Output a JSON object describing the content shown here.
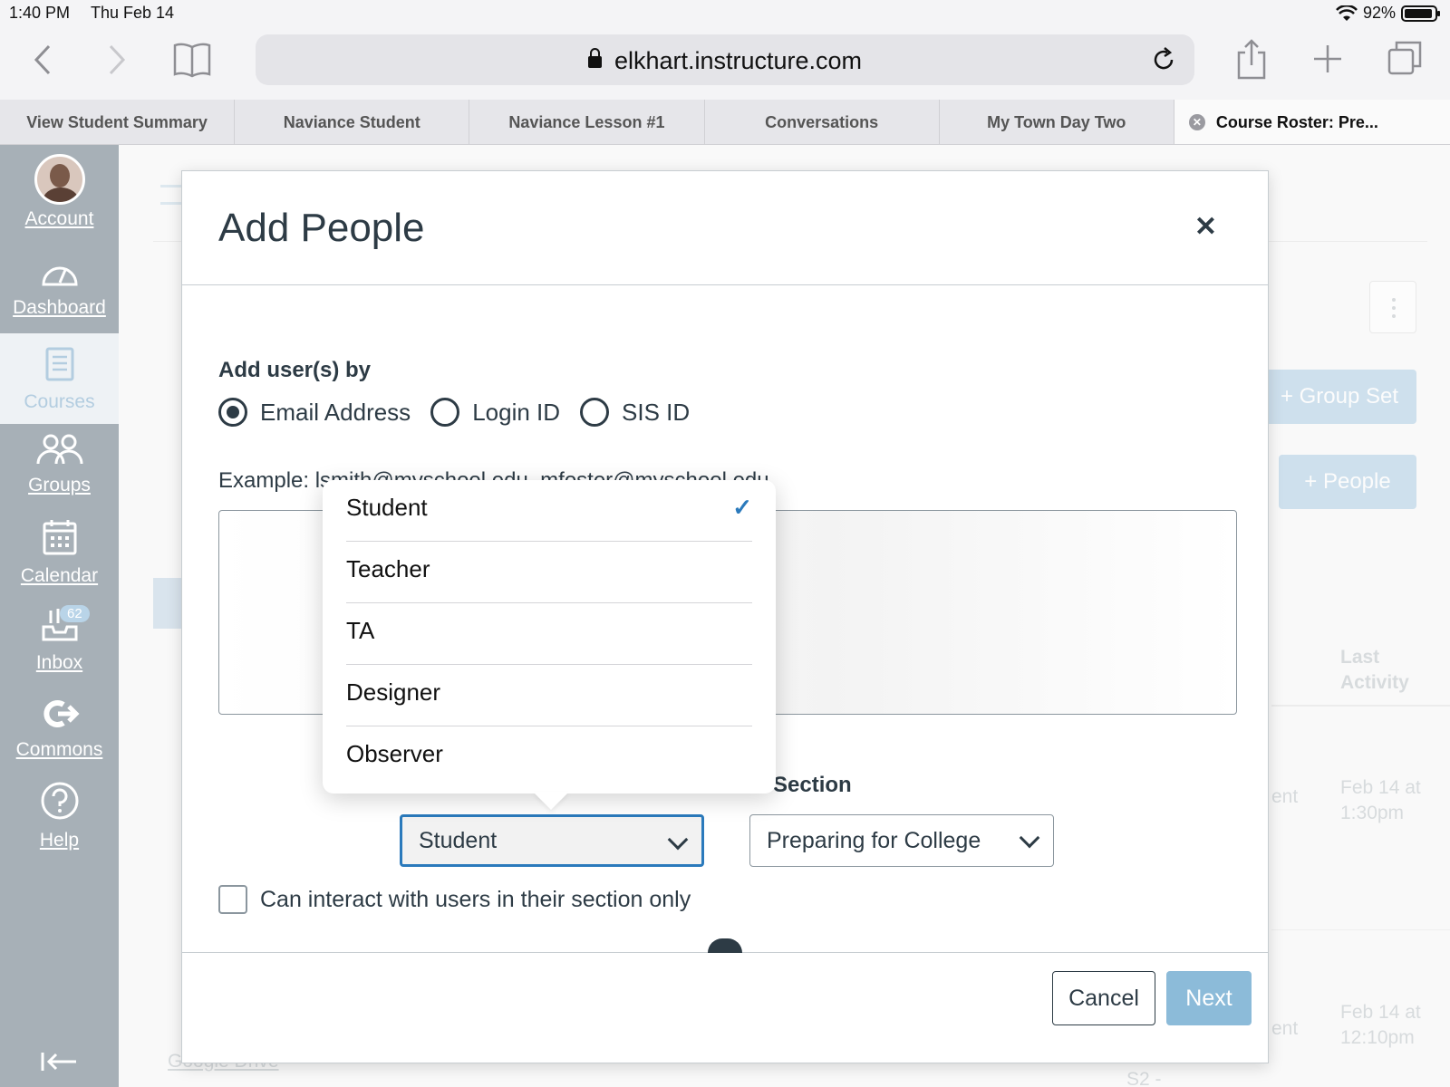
{
  "status_bar": {
    "time": "1:40 PM",
    "date": "Thu Feb 14",
    "battery": "92%"
  },
  "browser": {
    "url": "elkhart.instructure.com",
    "tabs": [
      {
        "label": "View Student Summary"
      },
      {
        "label": "Naviance Student"
      },
      {
        "label": "Naviance Lesson #1"
      },
      {
        "label": "Conversations"
      },
      {
        "label": "My Town Day Two"
      },
      {
        "label": "Course Roster: Pre..."
      }
    ]
  },
  "global_nav": {
    "items": [
      {
        "label": "Account",
        "icon": "avatar"
      },
      {
        "label": "Dashboard",
        "icon": "dashboard-icon"
      },
      {
        "label": "Courses",
        "icon": "courses-icon"
      },
      {
        "label": "Groups",
        "icon": "groups-icon"
      },
      {
        "label": "Calendar",
        "icon": "calendar-icon"
      },
      {
        "label": "Inbox",
        "icon": "inbox-icon",
        "badge": "62"
      },
      {
        "label": "Commons",
        "icon": "commons-icon"
      },
      {
        "label": "Help",
        "icon": "help-icon"
      }
    ]
  },
  "background": {
    "group_set_button": "Group Set",
    "people_button": "People",
    "column_last_activity": "Last Activity",
    "row1_activity": "Feb 14 at 1:30pm",
    "row2_activity": "Feb 14 at 12:10pm",
    "partial_ent1": "ent",
    "partial_ent2": "ent",
    "partial_s2": "S2 -",
    "partial_drive": "Google Drive"
  },
  "modal": {
    "title": "Add People",
    "add_by_label": "Add user(s) by",
    "radio_options": [
      {
        "label": "Email Address",
        "checked": true
      },
      {
        "label": "Login ID",
        "checked": false
      },
      {
        "label": "SIS ID",
        "checked": false
      }
    ],
    "example_text": "Example: lsmith@myschool.edu, mfoster@myschool.edu",
    "textarea_value": "",
    "section_heading": "Section",
    "role_value": "Student",
    "section_value": "Preparing for College",
    "checkbox_label": "Can interact with users in their section only",
    "cancel_label": "Cancel",
    "next_label": "Next"
  },
  "role_dropdown": {
    "options": [
      {
        "label": "Student",
        "selected": true
      },
      {
        "label": "Teacher",
        "selected": false
      },
      {
        "label": "TA",
        "selected": false
      },
      {
        "label": "Designer",
        "selected": false
      },
      {
        "label": "Observer",
        "selected": false
      }
    ]
  },
  "colors": {
    "accent": "#2b7abc",
    "next_button": "#8cbbd9",
    "nav_bg": "#a7b0b7",
    "text": "#2d3b45"
  }
}
